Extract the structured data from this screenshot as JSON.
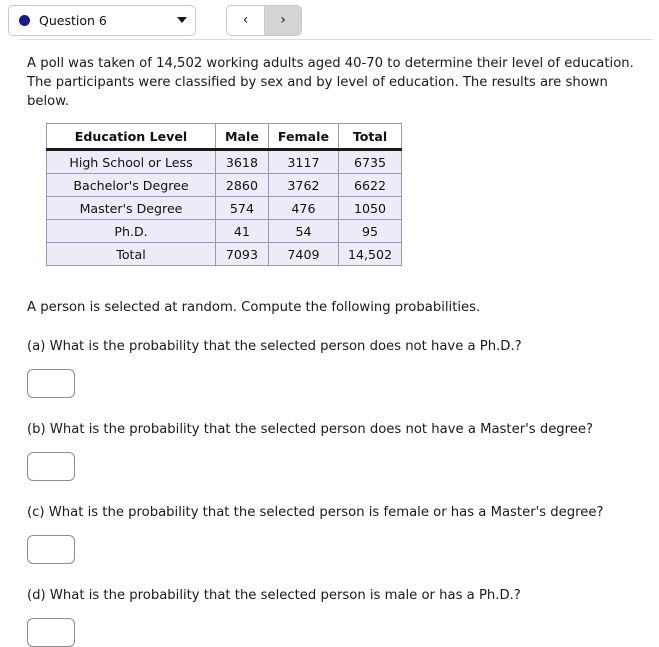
{
  "toolbar": {
    "question_selector": {
      "label": "Question 6",
      "dot_color": "#1a1a8c",
      "caret_icon": "chevron-down-icon"
    },
    "prev_button": {
      "glyph": "‹",
      "icon": "chevron-left-icon"
    },
    "next_button": {
      "glyph": "›",
      "icon": "chevron-right-icon"
    }
  },
  "main": {
    "intro": "A poll was taken of 14,502 working adults aged 40-70 to determine their level of education. The participants were classified by sex and by level of education. The results are shown below.",
    "prompt": "A person is selected at random. Compute the following probabilities.",
    "table": {
      "headers": [
        "Education Level",
        "Male",
        "Female",
        "Total"
      ],
      "rows": [
        [
          "High School or Less",
          "3618",
          "3117",
          "6735"
        ],
        [
          "Bachelor's Degree",
          "2860",
          "3762",
          "6622"
        ],
        [
          "Master's Degree",
          "574",
          "476",
          "1050"
        ],
        [
          "Ph.D.",
          "41",
          "54",
          "95"
        ],
        [
          "Total",
          "7093",
          "7409",
          "14,502"
        ]
      ]
    },
    "parts": [
      {
        "text": "(a) What is the probability that the selected person does not have a Ph.D.?",
        "answer": ""
      },
      {
        "text": "(b) What is the probability that the selected person does not have a Master's degree?",
        "answer": ""
      },
      {
        "text": "(c) What is the probability that the selected person is female or has a Master's degree?",
        "answer": ""
      },
      {
        "text": "(d) What is the probability that the selected person is male or has a Ph.D.?",
        "answer": ""
      }
    ]
  }
}
